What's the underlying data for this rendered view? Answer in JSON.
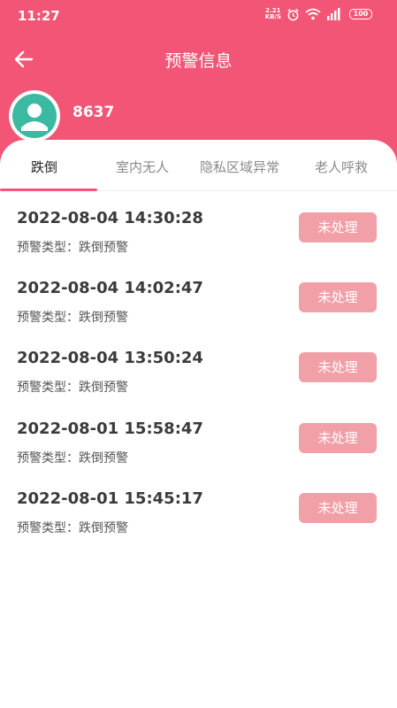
{
  "status_bar": {
    "time": "11:27",
    "net_speed_value": "2.21",
    "net_speed_unit": "KB/S",
    "battery": "100",
    "icons": [
      "alarm-icon",
      "wifi-icon",
      "signal-icon",
      "battery-icon"
    ]
  },
  "nav": {
    "back_icon": "arrow-left-icon",
    "title": "预警信息"
  },
  "profile": {
    "avatar_icon": "user-avatar-icon",
    "user_id": "8637"
  },
  "tabs": [
    {
      "label": "跌倒",
      "active": true
    },
    {
      "label": "室内无人",
      "active": false
    },
    {
      "label": "隐私区域异常",
      "active": false
    },
    {
      "label": "老人呼救",
      "active": false
    }
  ],
  "alerts": [
    {
      "time": "2022-08-04 14:30:28",
      "type_label": "预警类型：",
      "type_value": "跌倒预警",
      "status": "未处理"
    },
    {
      "time": "2022-08-04 14:02:47",
      "type_label": "预警类型：",
      "type_value": "跌倒预警",
      "status": "未处理"
    },
    {
      "time": "2022-08-04 13:50:24",
      "type_label": "预警类型：",
      "type_value": "跌倒预警",
      "status": "未处理"
    },
    {
      "time": "2022-08-01 15:58:47",
      "type_label": "预警类型：",
      "type_value": "跌倒预警",
      "status": "未处理"
    },
    {
      "time": "2022-08-01 15:45:17",
      "type_label": "预警类型：",
      "type_value": "跌倒预警",
      "status": "未处理"
    }
  ],
  "colors": {
    "brand": "#f25575",
    "status_button": "#f2a0a8",
    "avatar_bg": "#3bb9a1"
  }
}
